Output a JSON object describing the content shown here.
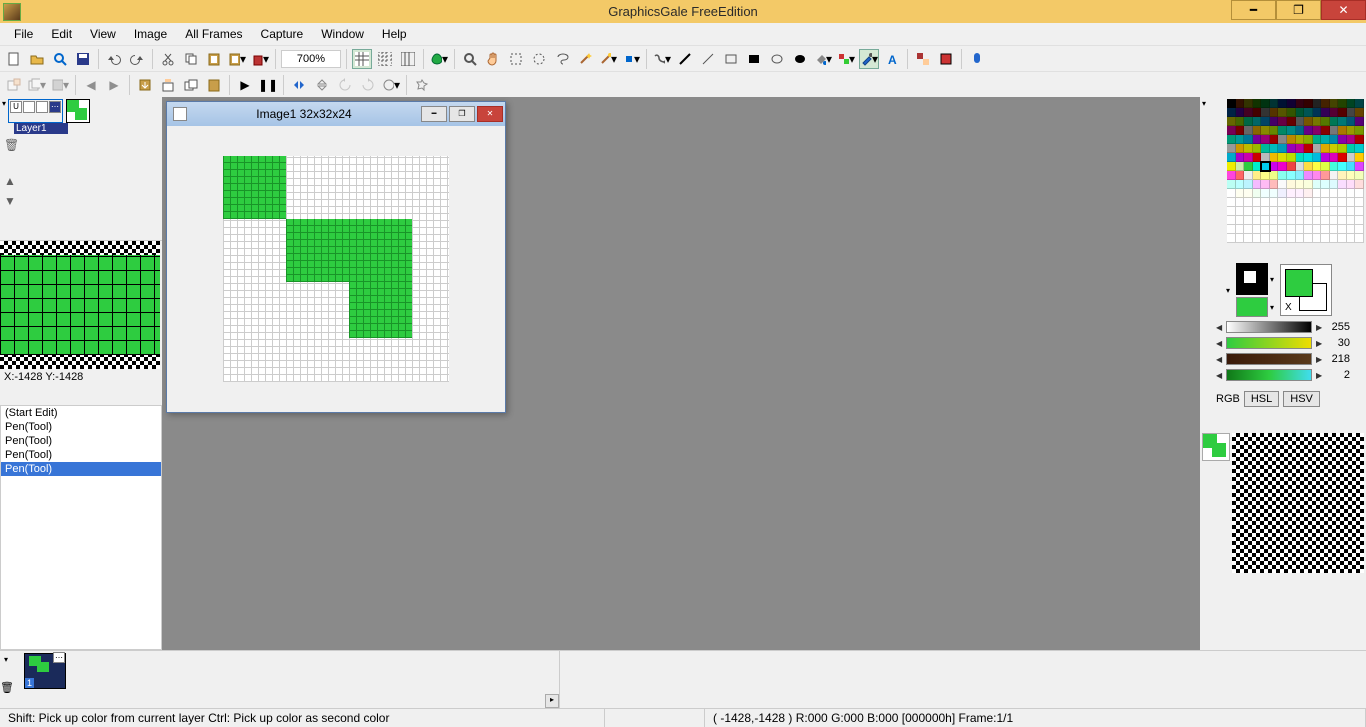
{
  "app": {
    "title": "GraphicsGale FreeEdition"
  },
  "menu": [
    "File",
    "Edit",
    "View",
    "Image",
    "All Frames",
    "Capture",
    "Window",
    "Help"
  ],
  "zoom": "700%",
  "doc": {
    "title": "Image1 32x32x24"
  },
  "layer": {
    "name": "Layer1"
  },
  "coords": "X:-1428 Y:-1428",
  "history": [
    {
      "label": "(Start Edit)",
      "sel": false
    },
    {
      "label": "Pen(Tool)",
      "sel": false
    },
    {
      "label": "Pen(Tool)",
      "sel": false
    },
    {
      "label": "Pen(Tool)",
      "sel": false
    },
    {
      "label": "Pen(Tool)",
      "sel": true
    }
  ],
  "sliders": [
    {
      "cls": "grad-gray",
      "val": "255"
    },
    {
      "cls": "grad-hue1",
      "val": "30"
    },
    {
      "cls": "grad-hue2",
      "val": "218"
    },
    {
      "cls": "grad-hue3",
      "val": "2"
    }
  ],
  "colormode": {
    "label": "RGB",
    "tabs": [
      "HSL",
      "HSV"
    ]
  },
  "swatch_x": "X",
  "frame": {
    "num": "1"
  },
  "status": {
    "hint": "Shift: Pick up color from current layer  Ctrl: Pick up color as second color",
    "info": "( -1428,-1428 )  R:000 G:000 B:000  [000000h]  Frame:1/1"
  },
  "palette": [
    "#000000",
    "#331100",
    "#333300",
    "#113300",
    "#003311",
    "#003333",
    "#001133",
    "#110033",
    "#330011",
    "#330000",
    "#222222",
    "#442200",
    "#444400",
    "#224400",
    "#004422",
    "#004444",
    "#002244",
    "#220044",
    "#440022",
    "#440000",
    "#333333",
    "#553300",
    "#555500",
    "#335500",
    "#005533",
    "#005555",
    "#003355",
    "#330055",
    "#550033",
    "#550000",
    "#444444",
    "#664400",
    "#666600",
    "#446600",
    "#006644",
    "#006666",
    "#004466",
    "#440066",
    "#660044",
    "#660000",
    "#555555",
    "#775500",
    "#777700",
    "#557700",
    "#007755",
    "#007777",
    "#005577",
    "#550077",
    "#770055",
    "#770000",
    "#666666",
    "#886600",
    "#888800",
    "#668800",
    "#008866",
    "#008888",
    "#006688",
    "#660088",
    "#880066",
    "#880000",
    "#777777",
    "#aa7700",
    "#999900",
    "#779900",
    "#009977",
    "#009999",
    "#007799",
    "#770099",
    "#990077",
    "#990000",
    "#888888",
    "#bb8800",
    "#aaaa00",
    "#88aa00",
    "#00aa88",
    "#00aaaa",
    "#0088aa",
    "#8800aa",
    "#aa0088",
    "#aa0000",
    "#999999",
    "#cc9900",
    "#bbbb00",
    "#99bb00",
    "#00bb99",
    "#00bbbb",
    "#0099bb",
    "#9900bb",
    "#bb0099",
    "#bb0000",
    "#aaaaaa",
    "#ddaa00",
    "#cccc00",
    "#aacc00",
    "#00ccaa",
    "#00cccc",
    "#00aacc",
    "#aa00cc",
    "#cc00aa",
    "#cc0000",
    "#bbbbbb",
    "#eebb00",
    "#dddd00",
    "#bbdd00",
    "#00ddbb",
    "#00dddd",
    "#00bbdd",
    "#bb00dd",
    "#dd00bb",
    "#dd0000",
    "#cccccc",
    "#ffcc00",
    "#eeee00",
    "#cceeaa",
    "#2ecc40",
    "#00eecc",
    "#00ccee",
    "#cc00ee",
    "#ee00cc",
    "#ee4444",
    "#dddddd",
    "#ffdd44",
    "#ffff44",
    "#ddff44",
    "#44ffdd",
    "#44ffff",
    "#44ddff",
    "#dd44ff",
    "#ff44dd",
    "#ff6666",
    "#eeeeee",
    "#ffee88",
    "#ffff88",
    "#eeff88",
    "#88ffee",
    "#88ffff",
    "#88eeff",
    "#ee88ff",
    "#ff88ee",
    "#ff9999",
    "#f4f4f4",
    "#fff4bb",
    "#ffffbb",
    "#f4ffbb",
    "#bbfff4",
    "#bbffff",
    "#bbf4ff",
    "#f4bbff",
    "#ffbbf4",
    "#ffbbbb",
    "#fafafa",
    "#fffadd",
    "#ffffdd",
    "#faffdd",
    "#ddfffa",
    "#ddffff",
    "#ddfaff",
    "#faddff",
    "#ffddfa",
    "#ffdddd",
    "#ffffff",
    "#fffff0",
    "#fffff0",
    "#f0fff0",
    "#f0ffff",
    "#f0ffff",
    "#f0f0ff",
    "#fff0ff",
    "#fff0ff",
    "#fff0f0",
    "#ffffff",
    "#ffffff",
    "#ffffff",
    "#ffffff",
    "#ffffff",
    "#ffffff",
    "#ffffff",
    "#ffffff",
    "#ffffff",
    "#ffffff",
    "#ffffff",
    "#ffffff",
    "#ffffff",
    "#ffffff",
    "#ffffff",
    "#ffffff",
    "#ffffff",
    "#ffffff",
    "#ffffff",
    "#ffffff",
    "#ffffff",
    "#ffffff",
    "#ffffff",
    "#ffffff",
    "#ffffff",
    "#ffffff",
    "#ffffff",
    "#ffffff",
    "#ffffff",
    "#ffffff",
    "#ffffff",
    "#ffffff",
    "#ffffff",
    "#ffffff",
    "#ffffff",
    "#ffffff",
    "#ffffff",
    "#ffffff",
    "#ffffff",
    "#ffffff",
    "#ffffff",
    "#ffffff",
    "#ffffff",
    "#ffffff",
    "#ffffff",
    "#ffffff",
    "#ffffff",
    "#ffffff",
    "#ffffff",
    "#ffffff",
    "#ffffff",
    "#ffffff",
    "#ffffff",
    "#ffffff",
    "#ffffff",
    "#ffffff",
    "#ffffff",
    "#ffffff",
    "#ffffff",
    "#ffffff",
    "#ffffff",
    "#ffffff",
    "#ffffff",
    "#ffffff",
    "#ffffff",
    "#ffffff",
    "#ffffff",
    "#ffffff",
    "#ffffff",
    "#ffffff",
    "#ffffff",
    "#ffffff",
    "#ffffff",
    "#ffffff",
    "#ffffff",
    "#ffffff",
    "#ffffff",
    "#ffffff",
    "#ffffff",
    "#ffffff",
    "#ffffff",
    "#ffffff",
    "#ffffff",
    "#ffffff",
    "#ffffff",
    "#ffffff"
  ],
  "palette_selected": 116
}
